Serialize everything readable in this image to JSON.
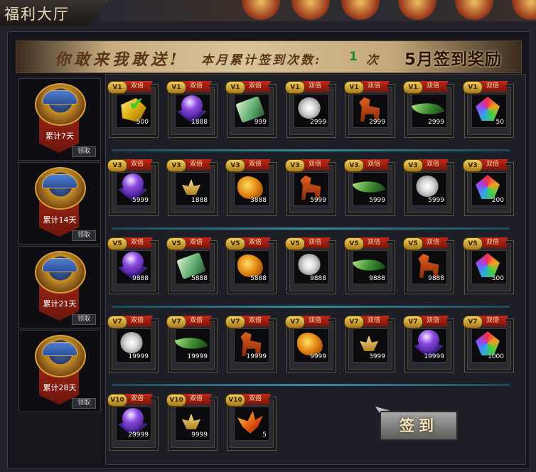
{
  "window": {
    "title": "福利大厅"
  },
  "banner": {
    "slogan": "你敢来我敢送!",
    "count_label": "本月累计签到次数:",
    "count_value": "1",
    "count_unit": "次",
    "title": "5月签到奖励"
  },
  "cumulative": [
    {
      "label": "累计7天",
      "claim": "领取"
    },
    {
      "label": "累计14天",
      "claim": "领取"
    },
    {
      "label": "累计21天",
      "claim": "领取"
    },
    {
      "label": "累计28天",
      "claim": "领取"
    }
  ],
  "double_label": "双倍",
  "rows": [
    {
      "vip": "V1",
      "items": [
        {
          "icon": "yellow-gem-icon",
          "qty": "500",
          "signed": true
        },
        {
          "icon": "purple-orb-icon",
          "qty": "1888"
        },
        {
          "icon": "green-scroll-icon",
          "qty": "999"
        },
        {
          "icon": "white-flower-icon",
          "qty": "2999"
        },
        {
          "icon": "red-horse-icon",
          "qty": "2999"
        },
        {
          "icon": "green-leaf-icon",
          "qty": "2999"
        },
        {
          "icon": "rainbow-gem-icon",
          "qty": "50"
        }
      ]
    },
    {
      "vip": "V3",
      "items": [
        {
          "icon": "purple-orb-icon",
          "qty": "5999"
        },
        {
          "icon": "golden-lotus-icon",
          "qty": "1888"
        },
        {
          "icon": "golden-dragon-icon",
          "qty": "3888"
        },
        {
          "icon": "red-horse-icon",
          "qty": "5999"
        },
        {
          "icon": "green-leaf-icon",
          "qty": "5999"
        },
        {
          "icon": "white-flower-icon",
          "qty": "5999"
        },
        {
          "icon": "rainbow-gem-icon",
          "qty": "200"
        }
      ]
    },
    {
      "vip": "V5",
      "items": [
        {
          "icon": "purple-orb-icon",
          "qty": "9888"
        },
        {
          "icon": "green-scroll-icon",
          "qty": "5888"
        },
        {
          "icon": "golden-dragon-icon",
          "qty": "5888"
        },
        {
          "icon": "white-flower-icon",
          "qty": "9888"
        },
        {
          "icon": "green-leaf-icon",
          "qty": "9888"
        },
        {
          "icon": "red-horse-icon",
          "qty": "9888"
        },
        {
          "icon": "rainbow-gem-icon",
          "qty": "500"
        }
      ]
    },
    {
      "vip": "V7",
      "items": [
        {
          "icon": "white-flower-icon",
          "qty": "19999"
        },
        {
          "icon": "green-leaf-icon",
          "qty": "19999"
        },
        {
          "icon": "red-horse-icon",
          "qty": "19999"
        },
        {
          "icon": "golden-dragon-icon",
          "qty": "9999"
        },
        {
          "icon": "golden-lotus-icon",
          "qty": "3999"
        },
        {
          "icon": "purple-orb-icon",
          "qty": "19999"
        },
        {
          "icon": "rainbow-gem-icon",
          "qty": "1000"
        }
      ]
    },
    {
      "vip": "V10",
      "items": [
        {
          "icon": "purple-orb-icon",
          "qty": "29999"
        },
        {
          "icon": "golden-lotus-icon",
          "qty": "9999"
        },
        {
          "icon": "phoenix-icon",
          "qty": "5"
        }
      ]
    }
  ],
  "signin_button": "签到"
}
